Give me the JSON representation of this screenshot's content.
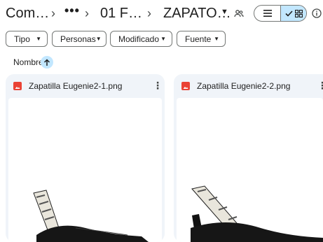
{
  "breadcrumb": {
    "root": "Com…",
    "overflow": "•••",
    "middle": "01 F…",
    "current": "ZAPATO…"
  },
  "icons": {
    "share": "people-icon",
    "list_view": "list-icon",
    "grid_view": "grid-icon",
    "check": "check-icon",
    "info": "info-icon"
  },
  "filters": {
    "type": "Tipo",
    "people": "Personas",
    "modified": "Modificado",
    "source": "Fuente"
  },
  "sort": {
    "label": "Nombre",
    "direction": "ascending"
  },
  "files": [
    {
      "name": "Zapatilla Eugenie2-1.png",
      "type_icon": "image-file-icon"
    },
    {
      "name": "Zapatilla Eugenie2-2.png",
      "type_icon": "image-file-icon"
    }
  ],
  "colors": {
    "accent": "#c2e7ff",
    "image_file": "#ea4335",
    "card_bg": "#f0f4f9"
  }
}
